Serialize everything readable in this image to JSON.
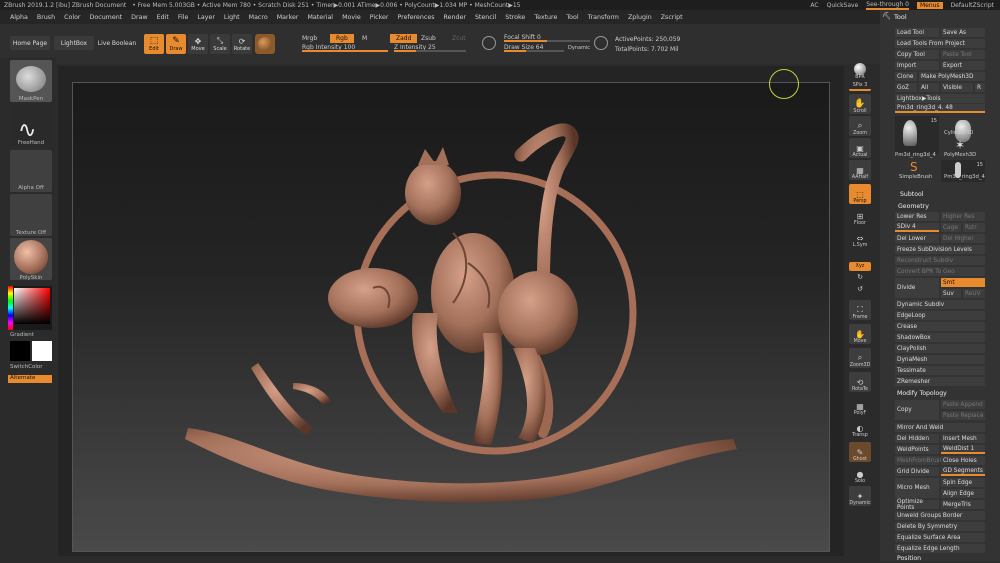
{
  "titlebar": {
    "title": "ZBrush 2019.1.2 [ibu]   ZBrush Document",
    "stats": "• Free Mem 5.003GB • Active Mem 780 • Scratch Disk 251 • Timer▶0.001 ATime▶0.006 • PolyCount▶1.034 MP • MeshCount▶15",
    "ac": "AC",
    "quicksave": "QuickSave",
    "seethrough": "See-through   0",
    "menus": "Menus",
    "script": "DefaultZScript"
  },
  "menubar": {
    "items": [
      "Alpha",
      "Brush",
      "Color",
      "Document",
      "Draw",
      "Edit",
      "File",
      "Layer",
      "Light",
      "Macro",
      "Marker",
      "Material",
      "Movie",
      "Picker",
      "Preferences",
      "Render",
      "Stencil",
      "Stroke",
      "Texture",
      "Tool",
      "Transform",
      "Zplugin",
      "Zscript"
    ],
    "tool_label": "Tool"
  },
  "toolbar": {
    "home_page": "Home Page",
    "lightbox": "LightBox",
    "live_boolean": "Live Boolean",
    "edit": "Edit",
    "draw": "Draw",
    "move": "Move",
    "scale": "Scale",
    "rotate": "Rotate",
    "mrgb": "Mrgb",
    "rgb": "Rgb",
    "m": "M",
    "rgb_intensity": "Rgb Intensity 100",
    "zadd": "Zadd",
    "zsub": "Zsub",
    "zcut": "Zcut",
    "z_intensity": "Z Intensity 25",
    "focal_shift": "Focal Shift 0",
    "draw_size": "Draw Size 64",
    "dynamic": "Dynamic",
    "active_points": "ActivePoints: 250,059",
    "total_points": "TotalPoints: 7.702 Mil"
  },
  "leftpanel": {
    "maskpen": "MaskPen",
    "freehand": "FreeHand",
    "alpha_off": "Alpha Off",
    "texture_off": "Texture Off",
    "polyskin": "PolySkin",
    "gradient": "Gradient",
    "switchcolor": "SwitchColor",
    "alternate": "Alternate"
  },
  "rightstrip": {
    "items": [
      "BPR",
      "SPix 3",
      "Scroll",
      "Zoom",
      "Actual",
      "AAHalf",
      "Persp",
      "Floor",
      "L.Sym",
      "Xyz",
      "",
      "",
      "Frame",
      "Move",
      "Zoom3D",
      "RotaTe",
      "PolyF",
      "Transp",
      "Ghost",
      "Solo",
      "Dynamic"
    ]
  },
  "toolpanel": {
    "load_tool": "Load Tool",
    "save_as": "Save As",
    "load_tools_from_project": "Load Tools From Project",
    "copy_tool": "Copy Tool",
    "paste_tool": "Paste Tool",
    "import": "Import",
    "export": "Export",
    "clone": "Clone",
    "make_polymesh3d": "Make PolyMesh3D",
    "goz": "GoZ",
    "all": "All",
    "visible": "Visible",
    "r": "R",
    "lightbox_tools": "Lightbox▶Tools",
    "current_tool": "Pm3d_ring3d_4. 48",
    "thumb_count": "15",
    "thumb1": "Pm3d_ring3d_4",
    "thumb2": "Cylinder3D",
    "thumb3": "PolyMesh3D",
    "thumb4": "SimpleBrush",
    "thumb5": "Pm3d_ring3d_4",
    "subtool": "Subtool",
    "geometry": "Geometry",
    "lower_res": "Lower Res",
    "higher_res": "Higher Res",
    "sdiv": "SDiv 4",
    "cage": "Cage",
    "rstr": "Rstr",
    "del_lower": "Del Lower",
    "del_higher": "Del Higher",
    "freeze_subdiv": "Freeze SubDivision Levels",
    "reconstruct_subdiv": "Reconstruct Subdiv",
    "convert_bpr": "Convert BPR To Geo",
    "divide": "Divide",
    "smt": "Smt",
    "suv": "Suv",
    "reuv": "ReUV",
    "list": [
      "Dynamic Subdiv",
      "EdgeLoop",
      "Crease",
      "ShadowBox",
      "ClayPolish",
      "DynaMesh",
      "Tessimate",
      "ZRemesher"
    ],
    "modify_topology": "Modify Topology",
    "copy": "Copy",
    "paste_append": "Paste Append",
    "paste_replace": "Paste Replace",
    "mirror_and_weld": "Mirror And Weld",
    "del_hidden": "Del Hidden",
    "insert_mesh": "Insert Mesh",
    "weld_points": "WeldPoints",
    "welddist": "WeldDist 1",
    "meshfrombrush": "MeshFromBrush",
    "close_holes": "Close Holes",
    "grid_divide": "Grid Divide",
    "gd_segments": "GD Segments",
    "spin_edge": "Spin Edge",
    "micro_mesh": "Micro Mesh",
    "align_edge": "Align Edge",
    "optimize_points": "Optimize Points",
    "mergetris": "MergeTris",
    "unweld_groups": "Unweld Groups Border",
    "delete_by_symmetry": "Delete By Symmetry",
    "equalize_surface": "Equalize Surface Area",
    "equalize_edge": "Equalize Edge Length",
    "position": "Position"
  },
  "colors": {
    "accent": "#e88a2e",
    "clay": "#b07a62",
    "panel": "#333333"
  }
}
